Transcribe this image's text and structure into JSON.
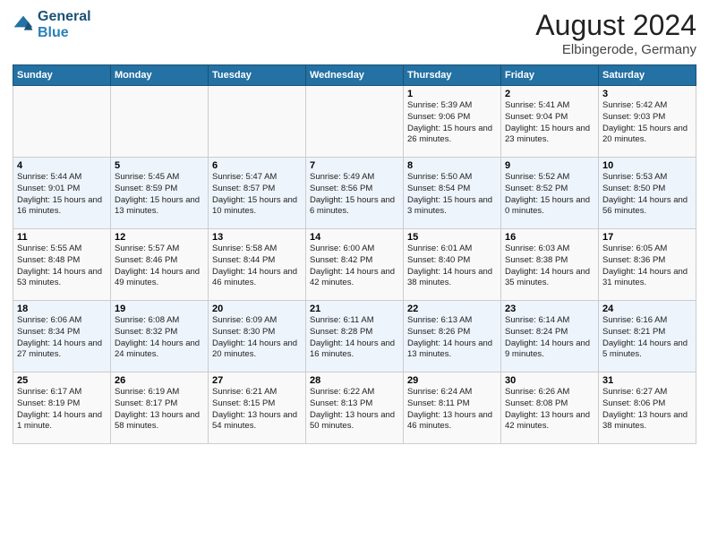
{
  "header": {
    "logo_line1": "General",
    "logo_line2": "Blue",
    "main_title": "August 2024",
    "subtitle": "Elbingerode, Germany"
  },
  "days_of_week": [
    "Sunday",
    "Monday",
    "Tuesday",
    "Wednesday",
    "Thursday",
    "Friday",
    "Saturday"
  ],
  "weeks": [
    [
      {
        "day": "",
        "info": ""
      },
      {
        "day": "",
        "info": ""
      },
      {
        "day": "",
        "info": ""
      },
      {
        "day": "",
        "info": ""
      },
      {
        "day": "1",
        "info": "Sunrise: 5:39 AM\nSunset: 9:06 PM\nDaylight: 15 hours\nand 26 minutes."
      },
      {
        "day": "2",
        "info": "Sunrise: 5:41 AM\nSunset: 9:04 PM\nDaylight: 15 hours\nand 23 minutes."
      },
      {
        "day": "3",
        "info": "Sunrise: 5:42 AM\nSunset: 9:03 PM\nDaylight: 15 hours\nand 20 minutes."
      }
    ],
    [
      {
        "day": "4",
        "info": "Sunrise: 5:44 AM\nSunset: 9:01 PM\nDaylight: 15 hours\nand 16 minutes."
      },
      {
        "day": "5",
        "info": "Sunrise: 5:45 AM\nSunset: 8:59 PM\nDaylight: 15 hours\nand 13 minutes."
      },
      {
        "day": "6",
        "info": "Sunrise: 5:47 AM\nSunset: 8:57 PM\nDaylight: 15 hours\nand 10 minutes."
      },
      {
        "day": "7",
        "info": "Sunrise: 5:49 AM\nSunset: 8:56 PM\nDaylight: 15 hours\nand 6 minutes."
      },
      {
        "day": "8",
        "info": "Sunrise: 5:50 AM\nSunset: 8:54 PM\nDaylight: 15 hours\nand 3 minutes."
      },
      {
        "day": "9",
        "info": "Sunrise: 5:52 AM\nSunset: 8:52 PM\nDaylight: 15 hours\nand 0 minutes."
      },
      {
        "day": "10",
        "info": "Sunrise: 5:53 AM\nSunset: 8:50 PM\nDaylight: 14 hours\nand 56 minutes."
      }
    ],
    [
      {
        "day": "11",
        "info": "Sunrise: 5:55 AM\nSunset: 8:48 PM\nDaylight: 14 hours\nand 53 minutes."
      },
      {
        "day": "12",
        "info": "Sunrise: 5:57 AM\nSunset: 8:46 PM\nDaylight: 14 hours\nand 49 minutes."
      },
      {
        "day": "13",
        "info": "Sunrise: 5:58 AM\nSunset: 8:44 PM\nDaylight: 14 hours\nand 46 minutes."
      },
      {
        "day": "14",
        "info": "Sunrise: 6:00 AM\nSunset: 8:42 PM\nDaylight: 14 hours\nand 42 minutes."
      },
      {
        "day": "15",
        "info": "Sunrise: 6:01 AM\nSunset: 8:40 PM\nDaylight: 14 hours\nand 38 minutes."
      },
      {
        "day": "16",
        "info": "Sunrise: 6:03 AM\nSunset: 8:38 PM\nDaylight: 14 hours\nand 35 minutes."
      },
      {
        "day": "17",
        "info": "Sunrise: 6:05 AM\nSunset: 8:36 PM\nDaylight: 14 hours\nand 31 minutes."
      }
    ],
    [
      {
        "day": "18",
        "info": "Sunrise: 6:06 AM\nSunset: 8:34 PM\nDaylight: 14 hours\nand 27 minutes."
      },
      {
        "day": "19",
        "info": "Sunrise: 6:08 AM\nSunset: 8:32 PM\nDaylight: 14 hours\nand 24 minutes."
      },
      {
        "day": "20",
        "info": "Sunrise: 6:09 AM\nSunset: 8:30 PM\nDaylight: 14 hours\nand 20 minutes."
      },
      {
        "day": "21",
        "info": "Sunrise: 6:11 AM\nSunset: 8:28 PM\nDaylight: 14 hours\nand 16 minutes."
      },
      {
        "day": "22",
        "info": "Sunrise: 6:13 AM\nSunset: 8:26 PM\nDaylight: 14 hours\nand 13 minutes."
      },
      {
        "day": "23",
        "info": "Sunrise: 6:14 AM\nSunset: 8:24 PM\nDaylight: 14 hours\nand 9 minutes."
      },
      {
        "day": "24",
        "info": "Sunrise: 6:16 AM\nSunset: 8:21 PM\nDaylight: 14 hours\nand 5 minutes."
      }
    ],
    [
      {
        "day": "25",
        "info": "Sunrise: 6:17 AM\nSunset: 8:19 PM\nDaylight: 14 hours\nand 1 minute."
      },
      {
        "day": "26",
        "info": "Sunrise: 6:19 AM\nSunset: 8:17 PM\nDaylight: 13 hours\nand 58 minutes."
      },
      {
        "day": "27",
        "info": "Sunrise: 6:21 AM\nSunset: 8:15 PM\nDaylight: 13 hours\nand 54 minutes."
      },
      {
        "day": "28",
        "info": "Sunrise: 6:22 AM\nSunset: 8:13 PM\nDaylight: 13 hours\nand 50 minutes."
      },
      {
        "day": "29",
        "info": "Sunrise: 6:24 AM\nSunset: 8:11 PM\nDaylight: 13 hours\nand 46 minutes."
      },
      {
        "day": "30",
        "info": "Sunrise: 6:26 AM\nSunset: 8:08 PM\nDaylight: 13 hours\nand 42 minutes."
      },
      {
        "day": "31",
        "info": "Sunrise: 6:27 AM\nSunset: 8:06 PM\nDaylight: 13 hours\nand 38 minutes."
      }
    ]
  ]
}
